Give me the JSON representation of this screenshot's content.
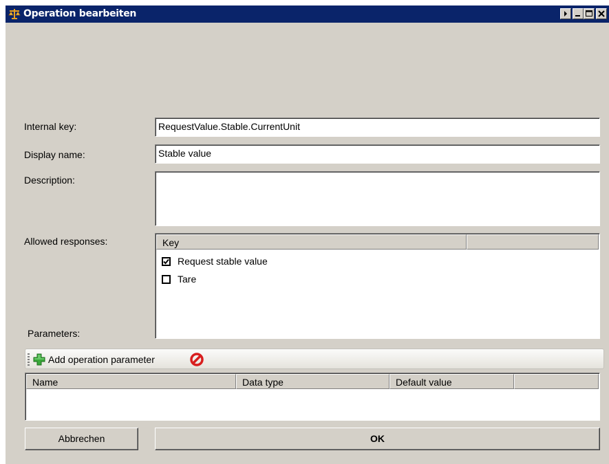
{
  "window": {
    "title": "Operation bearbeiten"
  },
  "form": {
    "internal_key_label": "Internal key:",
    "internal_key_value": "RequestValue.Stable.CurrentUnit",
    "display_name_label": "Display name:",
    "display_name_value": "Stable value",
    "description_label": "Description:",
    "description_value": "",
    "allowed_responses_label": "Allowed responses:",
    "parameters_label": "Parameters:"
  },
  "responses": {
    "columns": [
      "Key",
      ""
    ],
    "items": [
      {
        "label": "Request stable value",
        "checked": true
      },
      {
        "label": "Tare",
        "checked": false
      }
    ]
  },
  "toolbar": {
    "add_label": "Add operation parameter",
    "add_icon": "green-plus-icon",
    "delete_icon": "red-no-entry-icon"
  },
  "parameters": {
    "columns": [
      "Name",
      "Data type",
      "Default value",
      ""
    ],
    "rows": []
  },
  "buttons": {
    "cancel": "Abbrechen",
    "ok": "OK"
  },
  "colors": {
    "titlebar": "#0a246a",
    "window": "#d4d0c8"
  }
}
